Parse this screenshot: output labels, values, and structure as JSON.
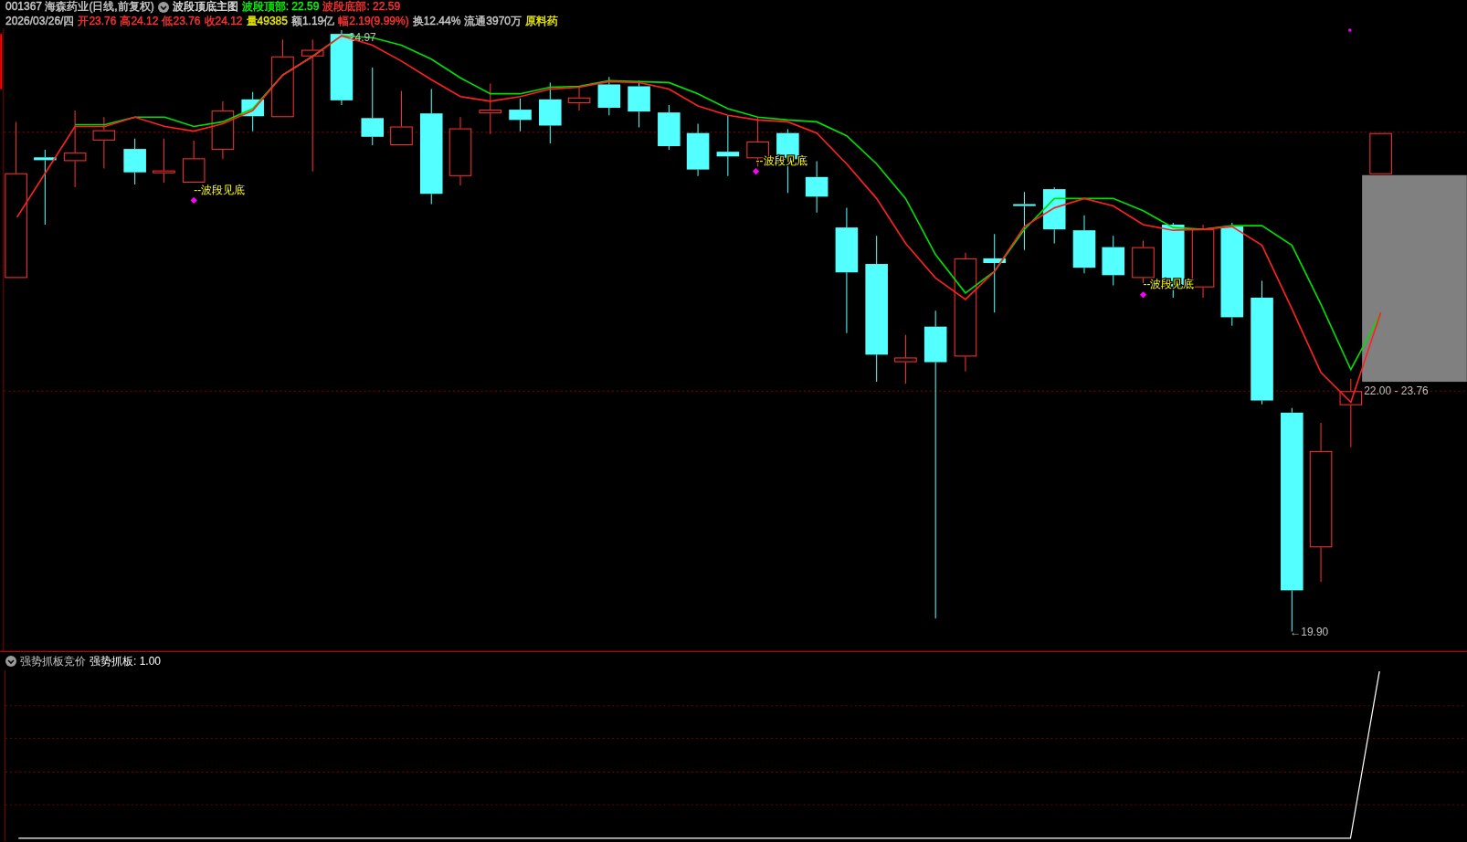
{
  "header": {
    "title": "001367 海森药业(日线,前复权)",
    "indicator": "波段顶底主图",
    "values": [
      {
        "text": "波段顶部: 22.59",
        "color": "#00ff00"
      },
      {
        "text": "波段底部: 22.59",
        "color": "#ff3232"
      }
    ]
  },
  "quote": [
    {
      "text": "2026/03/26/四",
      "color": "#c8c8c8"
    },
    {
      "text": "开23.76",
      "color": "#ff3232"
    },
    {
      "text": "高24.12",
      "color": "#ff3232"
    },
    {
      "text": "低23.76",
      "color": "#ff3232"
    },
    {
      "text": "收24.12",
      "color": "#ff3232"
    },
    {
      "text": "量49385",
      "color": "#e8e800"
    },
    {
      "text": "额1.19亿",
      "color": "#c8c8c8"
    },
    {
      "text": "幅2.19(9.99%)",
      "color": "#ff3232"
    },
    {
      "text": "换12.44%",
      "color": "#c8c8c8"
    },
    {
      "text": "流通3970万",
      "color": "#c8c8c8"
    },
    {
      "text": "原料药",
      "color": "#e8e800"
    }
  ],
  "main_chart": {
    "signals": [
      {
        "text": "--波段见底"
      },
      {
        "text": "--波段见底"
      },
      {
        "text": "--波段见底"
      }
    ],
    "price_labels": [
      {
        "text": "←24.97"
      },
      {
        "text": "←19.90"
      },
      {
        "text": "22.00 - 23.76"
      }
    ]
  },
  "lower_panel": {
    "indicator": "强势抓板竞价",
    "value": "强势抓板: 1.00"
  }
}
